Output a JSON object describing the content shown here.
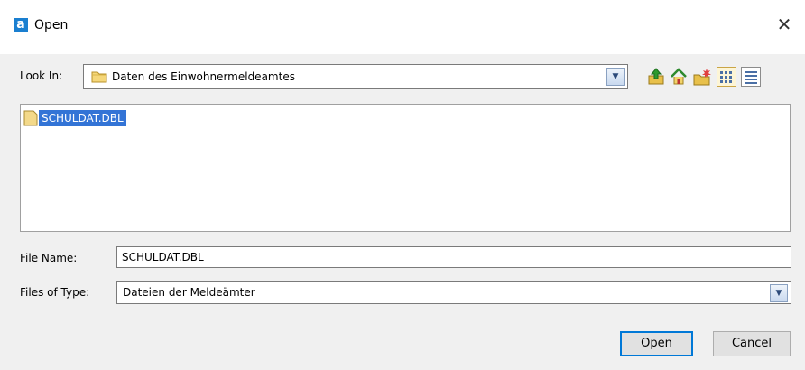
{
  "window": {
    "title": "Open",
    "app_icon_glyph": "a",
    "close_glyph": "✕"
  },
  "look_in": {
    "label": "Look In:",
    "value": "Daten des Einwohnermeldeamtes"
  },
  "toolbar": {
    "icons": [
      "up-one-level-icon",
      "home-icon",
      "new-folder-icon",
      "list-view-icon",
      "details-view-icon"
    ]
  },
  "file_list": {
    "items": [
      {
        "name": "SCHULDAT.DBL",
        "selected": true,
        "icon": "file-icon"
      }
    ]
  },
  "file_name": {
    "label": "File Name:",
    "value": "SCHULDAT.DBL"
  },
  "files_of_type": {
    "label": "Files of Type:",
    "value": "Dateien der Meldeämter"
  },
  "buttons": {
    "open": "Open",
    "cancel": "Cancel"
  },
  "colors": {
    "selection": "#3374d6",
    "accent": "#1a7fd0",
    "background": "#f0f0f0"
  }
}
